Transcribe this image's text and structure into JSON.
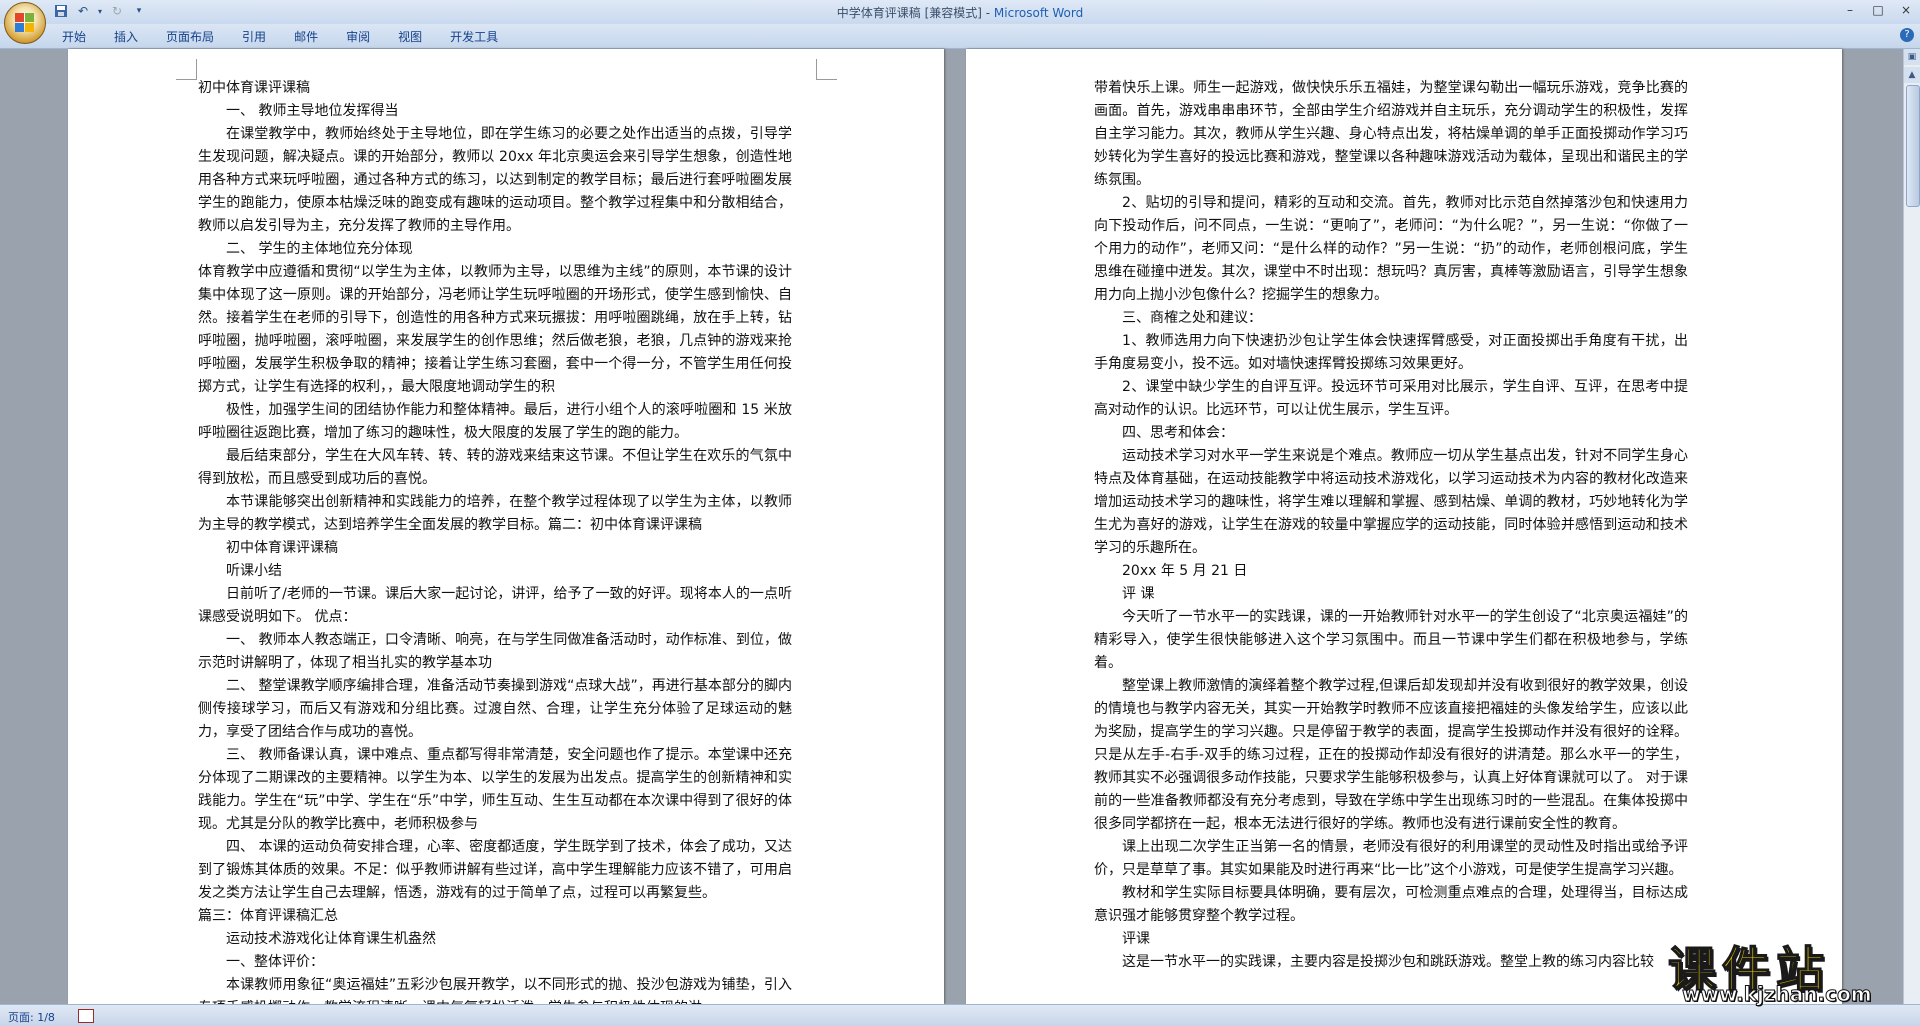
{
  "window": {
    "doc_title": "中学体育评课稿 [兼容模式] - ",
    "app_name": "Microsoft Word",
    "minimize": "–",
    "maximize": "□",
    "close": "×"
  },
  "ribbon": {
    "tabs": [
      "开始",
      "插入",
      "页面布局",
      "引用",
      "邮件",
      "审阅",
      "视图",
      "开发工具"
    ],
    "help": "?"
  },
  "status": {
    "page_info": "页面: 1/8"
  },
  "watermark": {
    "title": "课件站",
    "url": "www.kjzhan.com"
  },
  "page_left": [
    {
      "t": "初中体育课评课稿",
      "cls": "ni"
    },
    {
      "t": "一、  教师主导地位发挥得当",
      "cls": "i1"
    },
    {
      "t": "在课堂教学中，教师始终处于主导地位，即在学生练习的必要之处作出适当的点拨，引导学生发现问题，解决疑点。课的开始部分，教师以 20xx 年北京奥运会来引导学生想象，创造性地用各种方式来玩呼啦圈，通过各种方式的练习，以达到制定的教学目标；最后进行套呼啦圈发展学生的跑能力，使原本枯燥泛味的跑变成有趣味的运动项目。整个教学过程集中和分散相结合，教师以启发引导为主，充分发挥了教师的主导作用。",
      "cls": ""
    },
    {
      "t": "二、  学生的主体地位充分体现",
      "cls": "i1"
    },
    {
      "t": "体育教学中应遵循和贯彻“以学生为主体，以教师为主导，以思维为主线”的原则，本节课的设计集中体现了这一原则。课的开始部分，冯老师让学生玩呼啦圈的开场形式，使学生感到愉快、自然。接着学生在老师的引导下，创造性的用各种方式来玩搌拔：用呼啦圈跳绳，放在手上转，钻呼啦圈，抛呼啦圈，滚呼啦圈，来发展学生的创作思维；然后做老狼，老狼，几点钟的游戏来抢呼啦圈，发展学生积极争取的精神；接着让学生练习套圈，套中一个得一分，不管学生用任何投掷方式，让学生有选择的权利，，最大限度地调动学生的积",
      "cls": "ni"
    },
    {
      "t": "极性，加强学生间的团结协作能力和整体精神。最后，进行小组个人的滚呼啦圈和 15 米放呼啦圈往返跑比赛，增加了练习的趣味性，极大限度的发展了学生的跑的能力。",
      "cls": ""
    },
    {
      "t": "最后结束部分，学生在大风车转、转、转的游戏来结束这节课。不但让学生在欢乐的气氛中得到放松，而且感受到成功后的喜悦。",
      "cls": ""
    },
    {
      "t": "本节课能够突出创新精神和实践能力的培养，在整个教学过程体现了以学生为主体，以教师为主导的教学模式，达到培养学生全面发展的教学目标。篇二：初中体育课评课稿",
      "cls": ""
    },
    {
      "t": "初中体育课评课稿",
      "cls": "i1"
    },
    {
      "t": "听课小结",
      "cls": "i1"
    },
    {
      "t": "日前听了/老师的一节课。课后大家一起讨论，讲评，给予了一致的好评。现将本人的一点听课感受说明如下。    优点：",
      "cls": ""
    },
    {
      "t": "一、  教师本人教态端正，口令清晰、响亮，在与学生同做准备活动时，动作标准、到位，做示范时讲解明了，体现了相当扎实的教学基本功",
      "cls": ""
    },
    {
      "t": "二、  整堂课教学顺序编排合理，准备活动节奏操到游戏“点球大战”，再进行基本部分的脚内侧传接球学习，而后又有游戏和分组比赛。过渡自然、合理，让学生充分体验了足球运动的魅力，享受了团结合作与成功的喜悦。",
      "cls": ""
    },
    {
      "t": "三、  教师备课认真，课中难点、重点都写得非常清楚，安全问题也作了提示。本堂课中还充分体现了二期课改的主要精神。以学生为本、以学生的发展为出发点。提高学生的创新精神和实践能力。学生在“玩”中学、学生在“乐”中学，师生互动、生生互动都在本次课中得到了很好的体现。尤其是分队的教学比赛中，老师积极参与",
      "cls": ""
    },
    {
      "t": "四、  本课的运动负荷安排合理，心率、密度都适度，学生既学到了技术，体会了成功，又达到了锻炼其体质的效果。不足：似乎教师讲解有些过详，高中学生理解能力应该不错了，可用启发之类方法让学生自己去理解，悟透，游戏有的过于简单了点，过程可以再繁复些。",
      "cls": ""
    },
    {
      "t": "篇三：体育评课稿汇总",
      "cls": "ni"
    },
    {
      "t": "运动技术游戏化让体育课生机盎然",
      "cls": "i1"
    },
    {
      "t": "一、整体评价：",
      "cls": "i1"
    },
    {
      "t": "本课教师用象征“奥运福娃”五彩沙包展开教学，以不同形式的抛、投沙包游戏为铺垫，引入专项手感投掷动作，教学流程清晰，课中气氛轻松活泼，学生参与积极性体现的淋",
      "cls": ""
    }
  ],
  "page_right": [
    {
      "t": "带着快乐上课。师生一起游戏，做快快乐乐五福娃，为整堂课勾勒出一幅玩乐游戏，竞争比赛的画面。首先，游戏串串串环节，全部由学生介绍游戏并自主玩乐，充分调动学生的积极性，发挥自主学习能力。其次，教师从学生兴趣、身心特点出发，将枯燥单调的单手正面投掷动作学习巧妙转化为学生喜好的投远比赛和游戏，整堂课以各种趣味游戏活动为载体，呈现出和谐民主的学练氛围。",
      "cls": "ni"
    },
    {
      "t": "2、贴切的引导和提问，精彩的互动和交流。首先，教师对比示范自然掉落沙包和快速用力向下投动作后，问不同点，一生说：“更响了”，老师问：“为什么呢？”，另一生说：“你做了一个用力的动作”，老师又问：“是什么样的动作？”另一生说：“扔”的动作，老师创根问底，学生思维在碰撞中迸发。其次，课堂中不时出现：想玩吗？真厉害，真棒等激励语言，引导学生想象用力向上抛小沙包像什么？挖掘学生的想象力。",
      "cls": ""
    },
    {
      "t": "三、商榷之处和建议：",
      "cls": "i1"
    },
    {
      "t": "1、教师选用力向下快速扔沙包让学生体会快速挥臂感受，对正面投掷出手角度有干扰，出手角度易变小，投不远。如对墙快速挥臂投掷练习效果更好。",
      "cls": ""
    },
    {
      "t": "2、课堂中缺少学生的自评互评。投远环节可采用对比展示，学生自评、互评，在思考中提高对动作的认识。比远环节，可以让优生展示，学生互评。",
      "cls": ""
    },
    {
      "t": "四、思考和体会：",
      "cls": "i1"
    },
    {
      "t": "运动技术学习对水平一学生来说是个难点。教师应一切从学生基点出发，针对不同学生身心特点及体育基础，在运动技能教学中将运动技术游戏化，以学习运动技术为内容的教材化改造来增加运动技术学习的趣味性，将学生难以理解和掌握、感到枯燥、单调的教材，巧妙地转化为学生尤为喜好的游戏，让学生在游戏的较量中掌握应学的运动技能，同时体验并感悟到运动和技术学习的乐趣所在。",
      "cls": ""
    },
    {
      "t": "20xx 年 5 月 21 日",
      "cls": "i1"
    },
    {
      "t": "评    课",
      "cls": "i1"
    },
    {
      "t": "今天听了一节水平一的实践课，课的一开始教师针对水平一的学生创设了“北京奥运福娃”的精彩导入，使学生很快能够进入这个学习氛围中。而且一节课中学生们都在积极地参与，学练着。",
      "cls": ""
    },
    {
      "t": "整堂课上教师激情的演绎着整个教学过程,但课后却发现却并没有收到很好的教学效果，创设的情境也与教学内容无关，其实一开始教学时教师不应该直接把福娃的头像发给学生，应该以此为奖励，提高学生的学习兴趣。只是停留于教学的表面，提高学生投掷动作并没有很好的诠释。只是从左手-右手-双手的练习过程，正在的投掷动作却没有很好的讲清楚。那么水平一的学生，教师其实不必强调很多动作技能，只要求学生能够积极参与，认真上好体育课就可以了。 对于课前的一些准备教师都没有充分考虑到，导致在学练中学生出现练习时的一些混乱。在集体投掷中很多同学都挤在一起，根本无法进行很好的学练。教师也没有进行课前安全性的教育。",
      "cls": ""
    },
    {
      "t": "课上出现二次学生正当第一名的情景，老师没有很好的利用课堂的灵动性及时指出或给予评价，只是草草了事。其实如果能及时进行再来“比一比”这个小游戏，可是使学生提高学习兴趣。",
      "cls": ""
    },
    {
      "t": "教材和学生实际目标要具体明确，要有层次，可检测重点难点的合理，处理得当，目标达成意识强才能够贯穿整个教学过程。",
      "cls": ""
    },
    {
      "t": "评课",
      "cls": "i1"
    },
    {
      "t": "这是一节水平一的实践课，主要内容是投掷沙包和跳跃游戏。整堂上教的练习内容比较",
      "cls": ""
    }
  ]
}
